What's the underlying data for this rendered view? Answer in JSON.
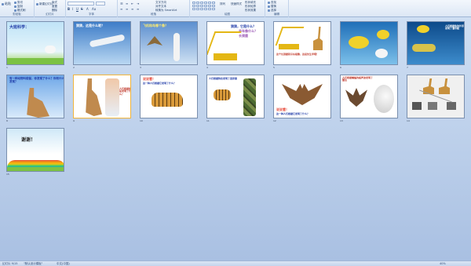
{
  "ribbon": {
    "groups": [
      {
        "label": "剪贴板"
      },
      {
        "label": "幻灯片"
      },
      {
        "label": "字体"
      },
      {
        "label": "段落"
      },
      {
        "label": "绘图"
      },
      {
        "label": "编辑"
      }
    ],
    "paste": "粘贴",
    "new_slide": "新建幻灯片",
    "layout": "版式",
    "reset": "重置",
    "delete": "删除",
    "cut": "剪切",
    "copy": "复制",
    "format_painter": "格式刷",
    "text_direction": "文字方向",
    "align_text": "对齐文本",
    "smartart": "转换为 SmartArt",
    "arrange": "排列",
    "quick_styles": "快速样式",
    "shape_fill": "形状填充",
    "shape_outline": "形状轮廓",
    "shape_effects": "形状效果",
    "find": "查找",
    "replace": "替换",
    "select": "选择"
  },
  "slides": [
    {
      "num": "1",
      "title": "大班科学："
    },
    {
      "num": "2",
      "text": "猜猜，这是什么呢？"
    },
    {
      "num": "3",
      "text": "飞机和鸟哪个像？"
    },
    {
      "num": "4",
      "text1": "猜猜，它是什么？",
      "text2": "吊车像什么？",
      "text3": "长颈鹿"
    },
    {
      "num": "5",
      "text": "这个长颈鹿和吊车相像，这是仿生学哦！"
    },
    {
      "num": "6",
      "text": ""
    },
    {
      "num": "7",
      "text": "人们根据鱼的外形发明了潜水艇"
    },
    {
      "num": "8",
      "text": "有一种动物叫袋鼠，你发现了什么？你有什么发现？"
    },
    {
      "num": "9",
      "text": "人们根据袋鼠发明了什么？"
    },
    {
      "num": "10",
      "text1": "说说看！",
      "text2": "这一种人们根据它发明了什么？"
    },
    {
      "num": "11",
      "text": "人们根据豹纹发明了迷彩服"
    },
    {
      "num": "12",
      "text1": "说说看！",
      "text2": "这一种人们根据它发明了什么？"
    },
    {
      "num": "13",
      "text": "人们根据蝙蝠的超声波发明了雷达"
    },
    {
      "num": "14",
      "text": ""
    },
    {
      "num": "15",
      "text": "谢谢！"
    }
  ],
  "status": {
    "slide_info": "幻灯片 9/15",
    "theme": "\"默认设计模板\"",
    "language": "中文(中国)",
    "zoom": "40%"
  },
  "colors": {
    "ribbon_bg": "#dce7f5",
    "work_bg": "#b9cde9",
    "selection": "#f2b53b"
  }
}
